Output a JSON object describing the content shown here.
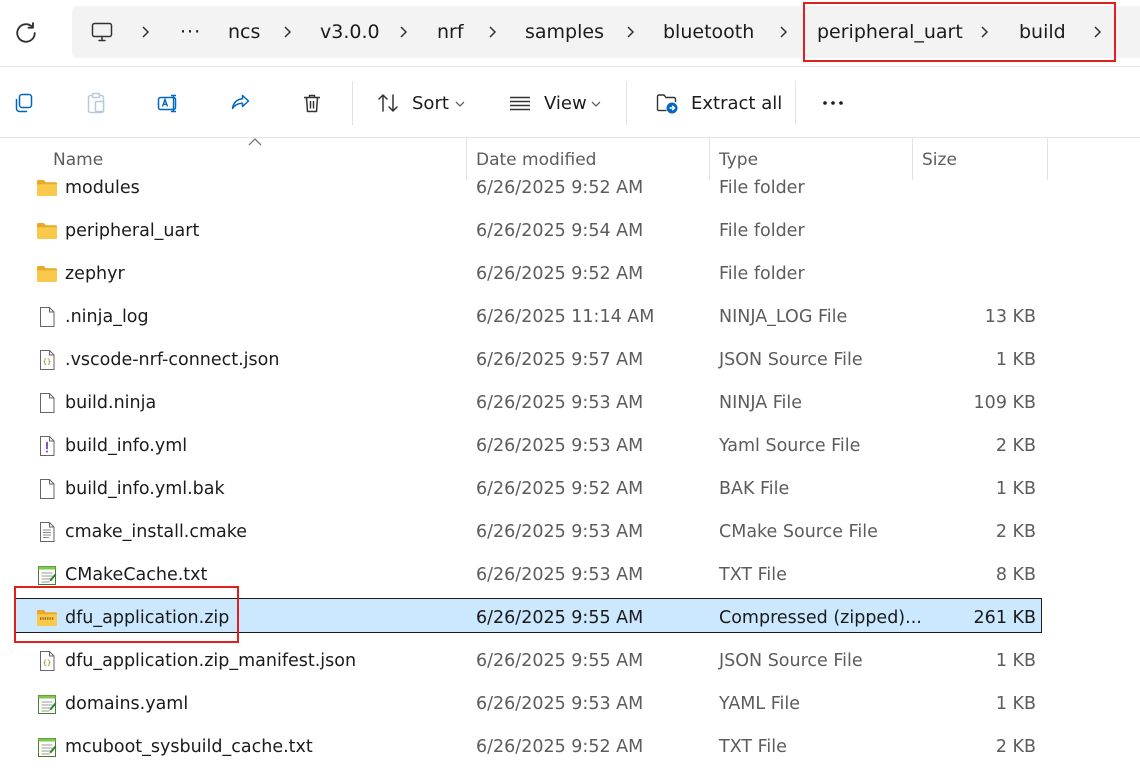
{
  "breadcrumb": {
    "items": [
      "ncs",
      "v3.0.0",
      "nrf",
      "samples",
      "bluetooth",
      "peripheral_uart",
      "build"
    ],
    "overflow": "···"
  },
  "toolbar": {
    "sort_label": "Sort",
    "view_label": "View",
    "extract_label": "Extract all"
  },
  "columns": {
    "name": "Name",
    "date": "Date modified",
    "type": "Type",
    "size": "Size"
  },
  "files": [
    {
      "name": "modules",
      "date": "6/26/2025 9:52 AM",
      "type": "File folder",
      "size": "",
      "icon": "folder-icon"
    },
    {
      "name": "peripheral_uart",
      "date": "6/26/2025 9:54 AM",
      "type": "File folder",
      "size": "",
      "icon": "folder-icon"
    },
    {
      "name": "zephyr",
      "date": "6/26/2025 9:52 AM",
      "type": "File folder",
      "size": "",
      "icon": "folder-icon"
    },
    {
      "name": ".ninja_log",
      "date": "6/26/2025 11:14 AM",
      "type": "NINJA_LOG File",
      "size": "13 KB",
      "icon": "blank-file-icon"
    },
    {
      "name": ".vscode-nrf-connect.json",
      "date": "6/26/2025 9:57 AM",
      "type": "JSON Source File",
      "size": "1 KB",
      "icon": "json-file-icon"
    },
    {
      "name": "build.ninja",
      "date": "6/26/2025 9:53 AM",
      "type": "NINJA File",
      "size": "109 KB",
      "icon": "blank-file-icon"
    },
    {
      "name": "build_info.yml",
      "date": "6/26/2025 9:53 AM",
      "type": "Yaml Source File",
      "size": "2 KB",
      "icon": "yaml-file-icon"
    },
    {
      "name": "build_info.yml.bak",
      "date": "6/26/2025 9:52 AM",
      "type": "BAK File",
      "size": "1 KB",
      "icon": "blank-file-icon"
    },
    {
      "name": "cmake_install.cmake",
      "date": "6/26/2025 9:53 AM",
      "type": "CMake Source File",
      "size": "2 KB",
      "icon": "text-file-icon"
    },
    {
      "name": "CMakeCache.txt",
      "date": "6/26/2025 9:53 AM",
      "type": "TXT File",
      "size": "8 KB",
      "icon": "notepad-file-icon"
    },
    {
      "name": "dfu_application.zip",
      "date": "6/26/2025 9:55 AM",
      "type": "Compressed (zipped)...",
      "size": "261 KB",
      "icon": "zip-folder-icon"
    },
    {
      "name": "dfu_application.zip_manifest.json",
      "date": "6/26/2025 9:55 AM",
      "type": "JSON Source File",
      "size": "1 KB",
      "icon": "json-file-icon"
    },
    {
      "name": "domains.yaml",
      "date": "6/26/2025 9:53 AM",
      "type": "YAML File",
      "size": "1 KB",
      "icon": "notepad-file-icon"
    },
    {
      "name": "mcuboot_sysbuild_cache.txt",
      "date": "6/26/2025 9:52 AM",
      "type": "TXT File",
      "size": "2 KB",
      "icon": "notepad-file-icon"
    }
  ],
  "selected_file": "dfu_application.zip",
  "colors": {
    "selection_bg": "#cce8ff",
    "highlight_box": "#e0201c",
    "folder": "#f8c94a",
    "accent": "#0067c0"
  }
}
